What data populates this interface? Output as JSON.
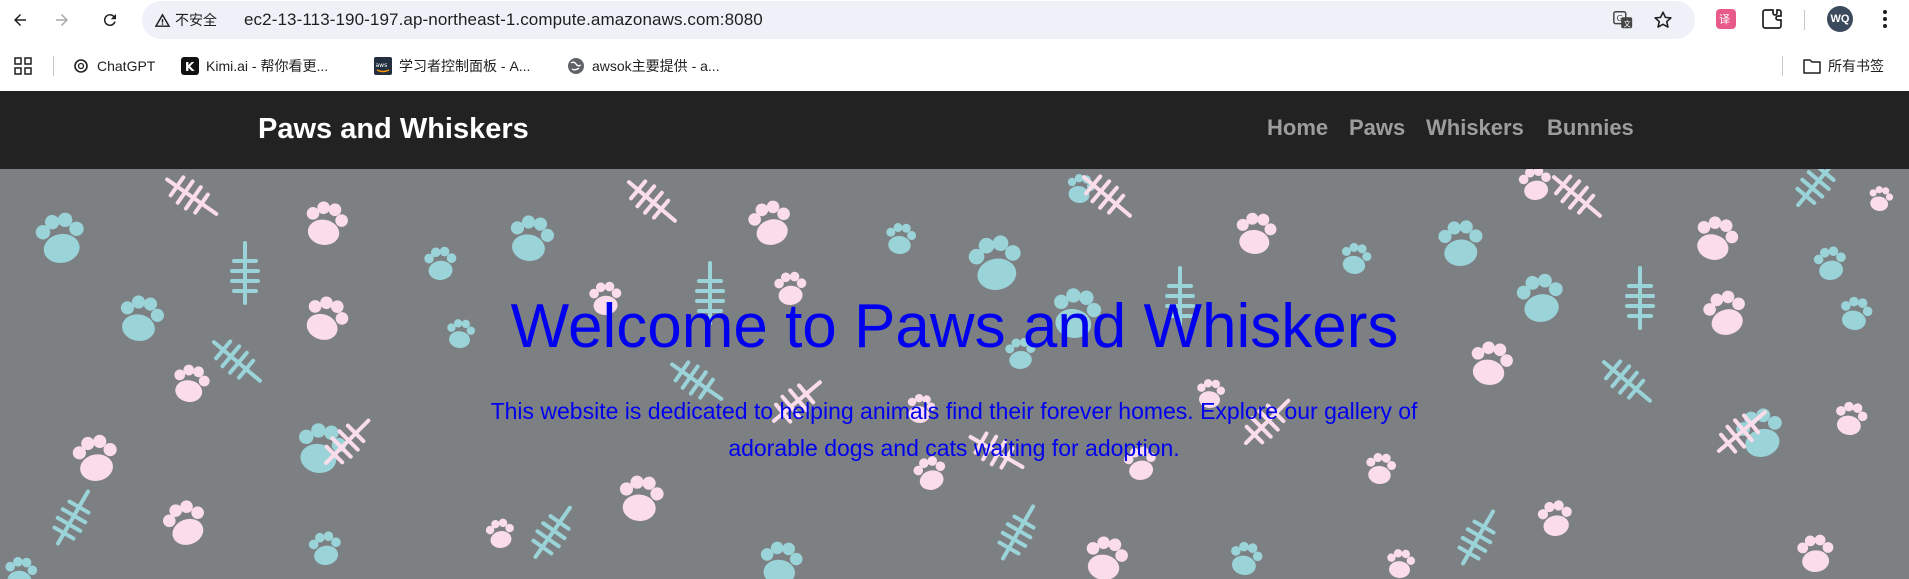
{
  "browser": {
    "security_label": "不安全",
    "url": "ec2-13-113-190-197.ap-northeast-1.compute.amazonaws.com:8080",
    "profile_initials": "WQ"
  },
  "bookmarks": {
    "items": [
      {
        "label": "ChatGPT",
        "icon": "chatgpt-icon"
      },
      {
        "label": "Kimi.ai - 帮你看更...",
        "icon": "kimi-icon"
      },
      {
        "label": "学习者控制面板 - A...",
        "icon": "aws-icon"
      },
      {
        "label": "awsok主要提供 - a...",
        "icon": "globe-icon"
      }
    ],
    "all_bookmarks_label": "所有书签"
  },
  "site": {
    "brand": "Paws and Whiskers",
    "menu": [
      "Home",
      "Paws",
      "Whiskers",
      "Bunnies"
    ]
  },
  "hero": {
    "title": "Welcome to Paws and Whiskers",
    "text": "This website is dedicated to helping animals find their forever homes. Explore our gallery of adorable dogs and cats waiting for adoption."
  },
  "colors": {
    "nav_bg": "#222222",
    "hero_bg": "#7d8083",
    "hero_text": "#0000ee",
    "paw_pink": "#fadcea",
    "paw_teal": "#9ad3d8"
  }
}
